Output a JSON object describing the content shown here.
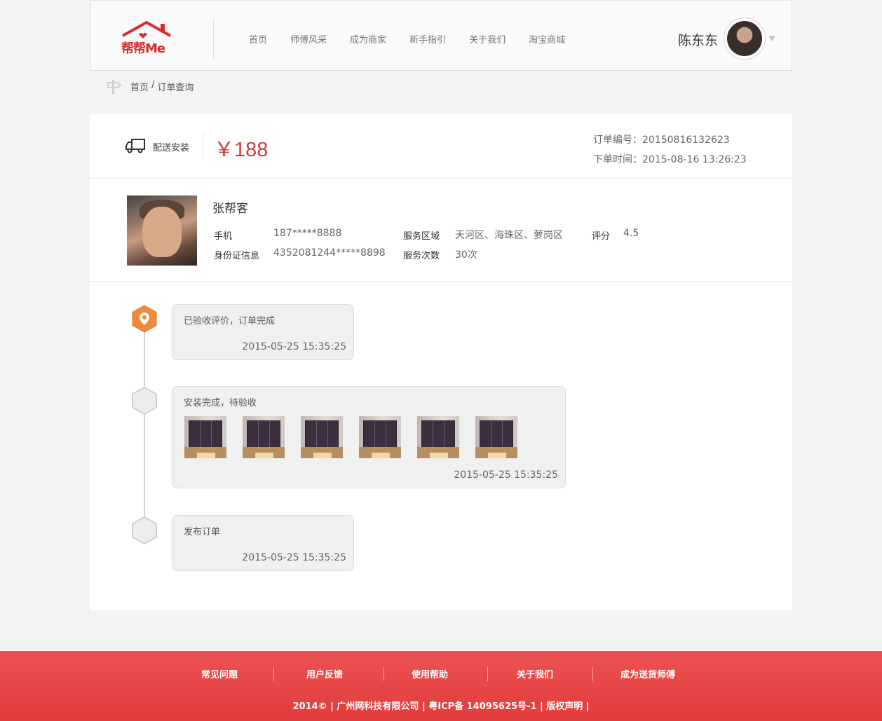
{
  "header": {
    "logo_text": "帮帮Me",
    "nav": [
      "首页",
      "师傅风采",
      "成为商家",
      "新手指引",
      "关于我们",
      "淘宝商城"
    ],
    "user_name": "陈东东"
  },
  "breadcrumb": {
    "home": "首页",
    "separator": "/",
    "current": "订单查询"
  },
  "order": {
    "service_type": "配送安装",
    "price": "￥188",
    "order_no_label": "订单编号：",
    "order_no": "20150816132623",
    "order_time_label": "下单时间：",
    "order_time": "2015-08-16 13:26:23"
  },
  "worker": {
    "name": "张帮客",
    "phone_label": "手机",
    "phone": "187*****8888",
    "id_label": "身份证信息",
    "id": "4352081244*****8898",
    "area_label": "服务区域",
    "area": "天河区、海珠区、萝岗区",
    "count_label": "服务次数",
    "count": "30次",
    "rating_label": "评分",
    "rating": "4.5"
  },
  "timeline": [
    {
      "text": "已验收评价，订单完成",
      "time": "2015-05-25 15:35:25",
      "active": true
    },
    {
      "text": "安装完成，待验收",
      "time": "2015-05-25 15:35:25",
      "active": false,
      "photos": 6
    },
    {
      "text": "发布订单",
      "time": "2015-05-25 15:35:25",
      "active": false
    }
  ],
  "footer": {
    "links": [
      "常见问题",
      "用户反馈",
      "使用帮助",
      "关于我们",
      "成为送货师傅"
    ],
    "copyright": "2014©  |  广州网科技有限公司  |  粤ICP备 14095625号-1  |  版权声明  |"
  },
  "colors": {
    "brand_red": "#e23c3c",
    "price_red": "#d13b3b",
    "active_orange": "#f08a3a"
  }
}
